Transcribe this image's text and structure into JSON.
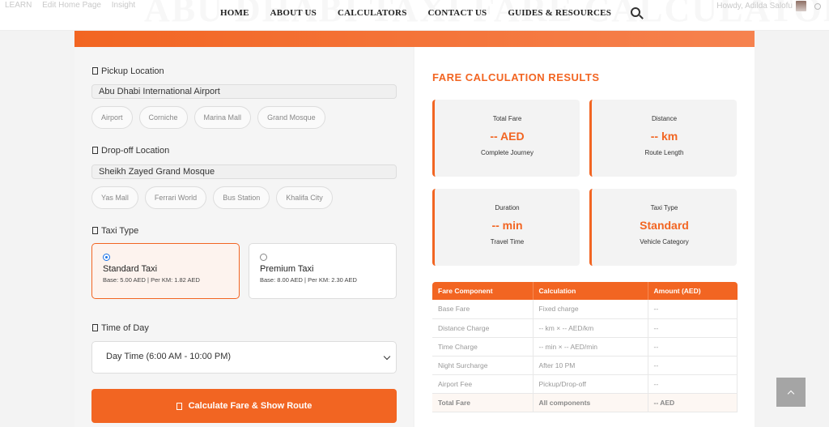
{
  "admin_bar": {
    "items": [
      "LEARN",
      "Edit Home Page",
      "Insight"
    ],
    "howdy": "Howdy, Adilda Salofu"
  },
  "hero_title_faded": "ABU DHABI TAXI FARE CALCULATOR",
  "nav": {
    "items": [
      "HOME",
      "ABOUT US",
      "CALCULATORS",
      "CONTACT US",
      "GUIDES & RESOURCES"
    ]
  },
  "form": {
    "pickup_label": "Pickup Location",
    "pickup_value": "Abu Dhabi International Airport",
    "pickup_chips": [
      "Airport",
      "Corniche",
      "Marina Mall",
      "Grand Mosque"
    ],
    "dropoff_label": "Drop-off Location",
    "dropoff_value": "Sheikh Zayed Grand Mosque",
    "dropoff_chips": [
      "Yas Mall",
      "Ferrari World",
      "Bus Station",
      "Khalifa City"
    ],
    "taxi_type_label": "Taxi Type",
    "taxi_options": [
      {
        "name": "Standard Taxi",
        "rate": "Base: 5.00 AED | Per KM: 1.82 AED",
        "selected": true
      },
      {
        "name": "Premium Taxi",
        "rate": "Base: 8.00 AED | Per KM: 2.30 AED",
        "selected": false
      }
    ],
    "time_label": "Time of Day",
    "time_value": "Day Time (6:00 AM - 10:00 PM)",
    "calc_button": "Calculate Fare & Show Route"
  },
  "results": {
    "title": "FARE CALCULATION RESULTS",
    "cards": [
      {
        "label": "Total Fare",
        "value": "-- AED",
        "sub": "Complete Journey"
      },
      {
        "label": "Distance",
        "value": "-- km",
        "sub": "Route Length"
      },
      {
        "label": "Duration",
        "value": "-- min",
        "sub": "Travel Time"
      },
      {
        "label": "Taxi Type",
        "value": "Standard",
        "sub": "Vehicle Category"
      }
    ],
    "table": {
      "headers": [
        "Fare Component",
        "Calculation",
        "Amount (AED)"
      ],
      "rows": [
        [
          "Base Fare",
          "Fixed charge",
          "--"
        ],
        [
          "Distance Charge",
          "-- km × -- AED/km",
          "--"
        ],
        [
          "Time Charge",
          "-- min × -- AED/min",
          "--"
        ],
        [
          "Night Surcharge",
          "After 10 PM",
          "--"
        ],
        [
          "Airport Fee",
          "Pickup/Drop-off",
          "--"
        ],
        [
          "Total Fare",
          "All components",
          "-- AED"
        ]
      ]
    }
  },
  "colors": {
    "accent": "#f26522",
    "radio_blue": "#1a73e8"
  }
}
